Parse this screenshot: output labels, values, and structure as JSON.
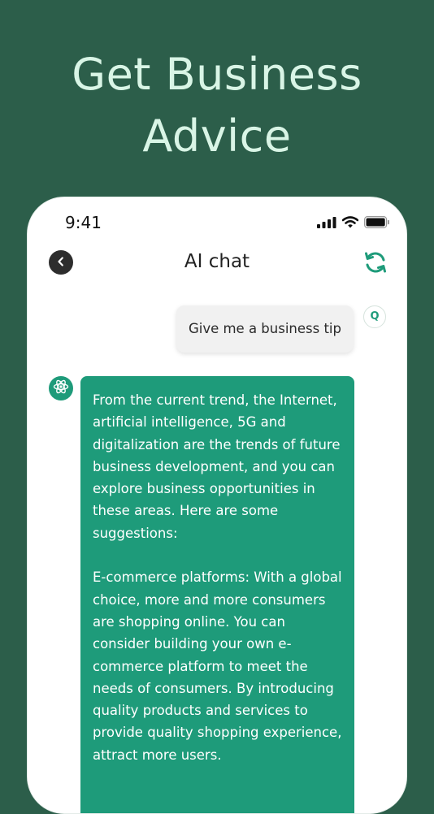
{
  "promo": {
    "title_line1": "Get Business",
    "title_line2": "Advice"
  },
  "status_bar": {
    "time": "9:41",
    "icons": [
      "cellular-signal-icon",
      "wifi-icon",
      "battery-icon"
    ]
  },
  "nav": {
    "back_icon": "chevron-left-icon",
    "title": "AI chat",
    "refresh_icon": "refresh-icon"
  },
  "chat": {
    "user_message": "Give me a business tip",
    "user_avatar_letter": "Q",
    "bot_avatar_icon": "atom-icon",
    "bot_message_paragraphs": [
      "From the current trend, the Internet, artificial intelligence, 5G and digitalization are the trends of future business development, and you can explore business opportunities in these areas. Here are some suggestions:",
      "E-commerce platforms: With a global choice, more and more consumers are shopping online. You can consider building your own e-commerce platform to meet the needs of consumers. By introducing quality products and services to provide quality shopping experience, attract more users."
    ]
  },
  "colors": {
    "background": "#2c5e4a",
    "title_text": "#d9f5e6",
    "accent": "#1e9b7a",
    "user_bubble": "#f1f1f1"
  }
}
